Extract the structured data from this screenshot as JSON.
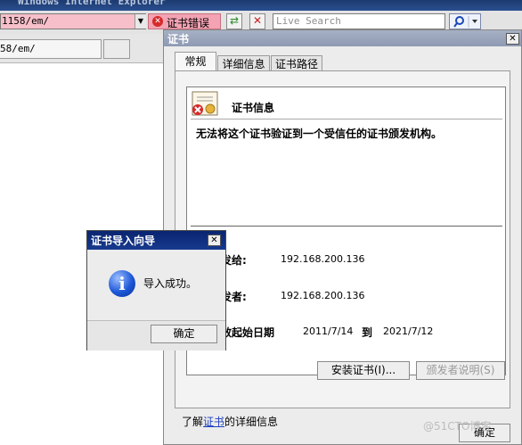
{
  "browser": {
    "window_title": "Windows Internet Explorer",
    "address_value": "1158/em/",
    "cert_error_label": "证书错误",
    "search_placeholder": "Live Search",
    "tab_label": "58/em/"
  },
  "cert_dialog": {
    "title": "证书",
    "tabs": [
      "常规",
      "详细信息",
      "证书路径"
    ],
    "info_heading": "证书信息",
    "warning": "无法将这个证书验证到一个受信任的证书颁发机构。",
    "issued_to_label": "颁发给:",
    "issued_to_value": "192.168.200.136",
    "issued_by_label": "颁发者:",
    "issued_by_value": "192.168.200.136",
    "valid_from_label": "有效起始日期",
    "valid_from_value": "2011/7/14",
    "valid_to_word": "到",
    "valid_to_value": "2021/7/12",
    "install_button": "安装证书(I)...",
    "issuer_statement_button": "颁发者说明(S)",
    "learn_more_prefix": "了解",
    "learn_more_link": "证书",
    "learn_more_suffix": "的详细信息",
    "ok_button": "确定"
  },
  "wizard_dialog": {
    "title": "证书导入向导",
    "message": "导入成功。",
    "ok_button": "确定"
  },
  "watermark": "@51CTO博客",
  "icons": {
    "close": "close-icon",
    "info": "info-icon",
    "error": "error-icon",
    "certificate": "certificate-icon",
    "refresh": "refresh-icon",
    "stop": "stop-icon",
    "search": "search-icon"
  }
}
